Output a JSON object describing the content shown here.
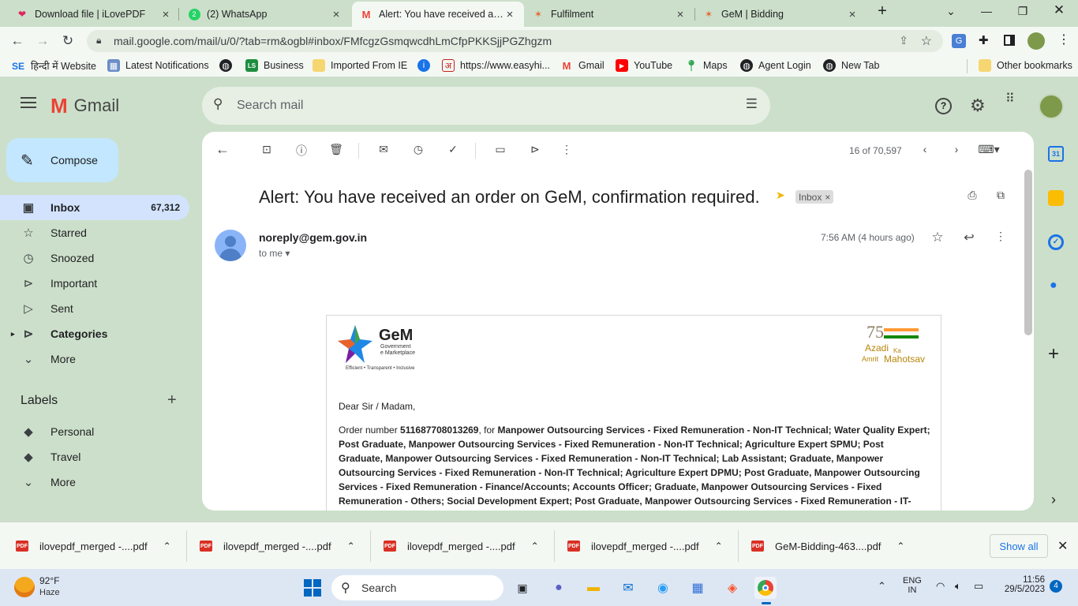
{
  "browser": {
    "tabs": [
      {
        "title": "Download file | iLovePDF",
        "icon": "heart-icon",
        "active": false
      },
      {
        "title": "(2) WhatsApp",
        "icon": "whatsapp-icon",
        "active": false
      },
      {
        "title": "Alert: You have received an o",
        "icon": "gmail-icon",
        "active": true
      },
      {
        "title": "Fulfilment",
        "icon": "gem-icon",
        "active": false
      },
      {
        "title": "GeM | Bidding",
        "icon": "gem-icon",
        "active": false
      }
    ],
    "url": "mail.google.com/mail/u/0/?tab=rm&ogbl#inbox/FMfcgzGsmqwcdhLmCfpPKKSjjPGZhgzm",
    "bookmarks": [
      {
        "label": "हिन्दी में Website",
        "icon": "se-icon"
      },
      {
        "label": "Latest Notifications",
        "icon": "notification-icon"
      },
      {
        "label": "",
        "icon": "globe-icon"
      },
      {
        "label": "Business",
        "icon": "ls-icon"
      },
      {
        "label": "Imported From IE",
        "icon": "folder-icon"
      },
      {
        "label": "",
        "icon": "info-icon"
      },
      {
        "label": "https://www.easyhi...",
        "icon": "hindi-icon"
      },
      {
        "label": "Gmail",
        "icon": "gmail-icon"
      },
      {
        "label": "YouTube",
        "icon": "youtube-icon"
      },
      {
        "label": "Maps",
        "icon": "maps-icon"
      },
      {
        "label": "Agent Login",
        "icon": "globe-icon"
      },
      {
        "label": "New Tab",
        "icon": "globe-icon"
      }
    ],
    "other_bookmarks": "Other bookmarks",
    "se_label": "SE",
    "hindi_short": "अ",
    "ls_short": "LS"
  },
  "gmail": {
    "logo": "Gmail",
    "search_placeholder": "Search mail",
    "compose": "Compose",
    "nav": [
      {
        "label": "Inbox",
        "count": "67,312",
        "icon": "inbox-icon",
        "bold": true
      },
      {
        "label": "Starred",
        "count": "",
        "icon": "star-icon"
      },
      {
        "label": "Snoozed",
        "count": "",
        "icon": "clock-icon"
      },
      {
        "label": "Important",
        "count": "",
        "icon": "important-icon"
      },
      {
        "label": "Sent",
        "count": "",
        "icon": "send-icon"
      },
      {
        "label": "Categories",
        "count": "",
        "icon": "label-icon",
        "bold": true
      },
      {
        "label": "More",
        "count": "",
        "icon": "chevron-down-icon"
      }
    ],
    "labels_heading": "Labels",
    "labels": [
      {
        "label": "Personal",
        "icon": "label-icon"
      },
      {
        "label": "Travel",
        "icon": "label-icon"
      },
      {
        "label": "More",
        "icon": "chevron-down-icon"
      }
    ],
    "pagination": "16 of 70,597",
    "subject": "Alert: You have received an order on GeM, confirmation required.",
    "inbox_chip": "Inbox",
    "sender": "noreply@gem.gov.in",
    "to": "to me",
    "time": "7:56 AM (4 hours ago)",
    "gem_logo": {
      "name": "GeM",
      "sub1": "Government",
      "sub2": "e Marketplace",
      "tagline": "Efficient • Transparent • Inclusive"
    },
    "azadi": {
      "num": "75",
      "line1": "Azadi",
      "ka": "Ka",
      "amrit": "Amrit",
      "mahotsav": "Mahotsav"
    },
    "greeting": "Dear Sir / Madam,",
    "order_prefix": "Order number ",
    "order_number": "511687708013269",
    "order_for": ", for ",
    "order_items": "Manpower Outsourcing Services - Fixed Remuneration - Non-IT Technical; Water Quality Expert; Post Graduate, Manpower Outsourcing Services - Fixed Remuneration - Non-IT Technical; Agriculture Expert SPMU; Post Graduate, Manpower Outsourcing Services - Fixed Remuneration - Non-IT Technical; Lab Assistant; Graduate, Manpower Outsourcing Services - Fixed Remuneration - Non-IT Technical; Agriculture Expert DPMU; Post Graduate, Manpower Outsourcing Services - Fixed Remuneration - Finance/Accounts; Accounts Officer; Graduate, Manpower Outsourcing Services - Fixed Remuneration - Others; Social Development Expert; Post Graduate, Manpower Outsourcing Services - Fixed Remuneration - IT-"
  },
  "downloads": {
    "items": [
      "ilovepdf_merged -....pdf",
      "ilovepdf_merged -....pdf",
      "ilovepdf_merged -....pdf",
      "ilovepdf_merged -....pdf",
      "GeM-Bidding-463....pdf"
    ],
    "pdf_badge": "PDF",
    "show_all": "Show all"
  },
  "taskbar": {
    "weather_temp": "92°F",
    "weather_desc": "Haze",
    "search": "Search",
    "lang1": "ENG",
    "lang2": "IN",
    "time": "11:56",
    "date": "29/5/2023",
    "notif_count": "4"
  }
}
